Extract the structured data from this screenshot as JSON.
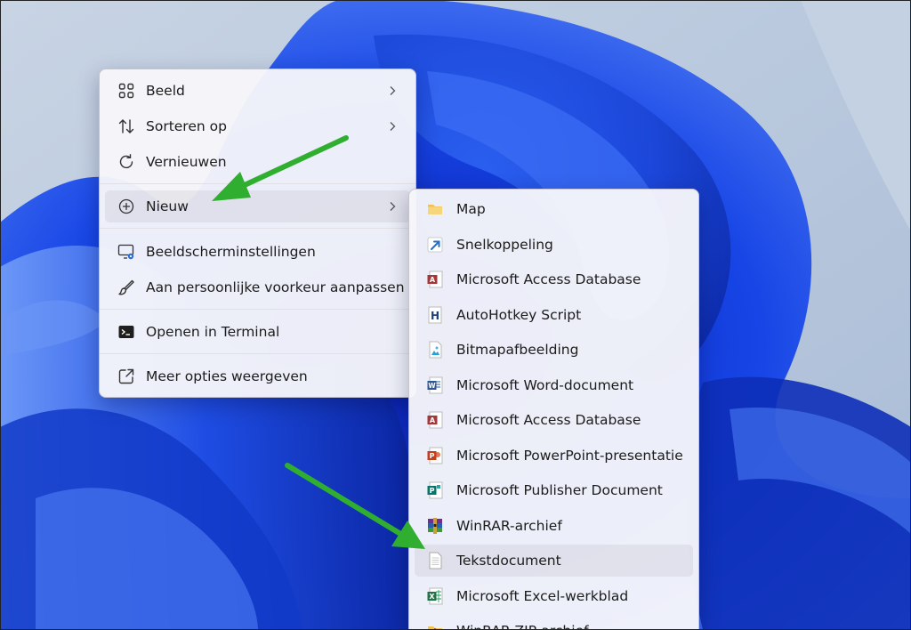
{
  "main_menu": {
    "items": [
      {
        "label": "Beeld",
        "icon": "grid-view-icon"
      },
      {
        "label": "Sorteren op",
        "icon": "sort-icon"
      },
      {
        "label": "Vernieuwen",
        "icon": "refresh-icon"
      },
      {
        "label": "Nieuw",
        "icon": "plus-circle-icon"
      },
      {
        "label": "Beeldscherminstellingen",
        "icon": "display-settings-icon"
      },
      {
        "label": "Aan persoonlijke voorkeur aanpassen",
        "icon": "brush-icon"
      },
      {
        "label": "Openen in Terminal",
        "icon": "terminal-icon"
      },
      {
        "label": "Meer opties weergeven",
        "icon": "expand-icon"
      }
    ]
  },
  "sub_menu": {
    "items": [
      {
        "label": "Map",
        "icon": "folder-icon"
      },
      {
        "label": "Snelkoppeling",
        "icon": "shortcut-icon"
      },
      {
        "label": "Microsoft Access Database",
        "icon": "access-icon"
      },
      {
        "label": "AutoHotkey Script",
        "icon": "autohotkey-icon"
      },
      {
        "label": "Bitmapafbeelding",
        "icon": "bitmap-icon"
      },
      {
        "label": "Microsoft Word-document",
        "icon": "word-icon"
      },
      {
        "label": "Microsoft Access Database",
        "icon": "access-icon"
      },
      {
        "label": "Microsoft PowerPoint-presentatie",
        "icon": "powerpoint-icon"
      },
      {
        "label": "Microsoft Publisher Document",
        "icon": "publisher-icon"
      },
      {
        "label": "WinRAR-archief",
        "icon": "winrar-icon"
      },
      {
        "label": "Tekstdocument",
        "icon": "text-document-icon"
      },
      {
        "label": "Microsoft Excel-werkblad",
        "icon": "excel-icon"
      },
      {
        "label": "WinRAR ZIP-archief",
        "icon": "winrar-zip-icon"
      }
    ]
  },
  "colors": {
    "accent_arrow": "#2fae2f",
    "wallpaper_blue": "#1d4fe0",
    "wallpaper_bg": "#b9c9de",
    "word_blue": "#2b579a",
    "access_red": "#a4373a",
    "powerpoint_orange": "#c43e1c",
    "publisher_teal": "#077568",
    "excel_green": "#217346",
    "folder_yellow": "#f2c14e"
  }
}
